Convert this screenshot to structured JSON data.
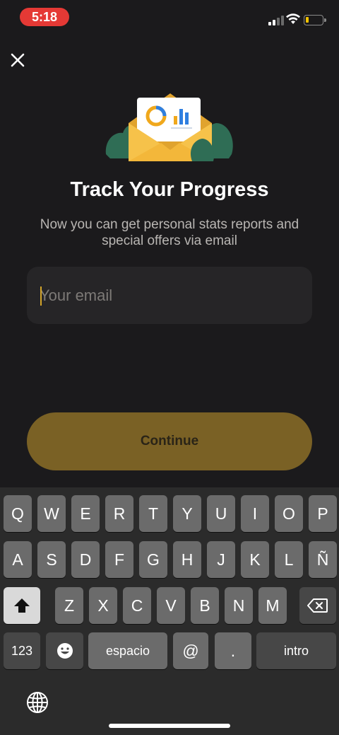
{
  "status": {
    "time": "5:18",
    "accent": "#e53935"
  },
  "header": {
    "close_icon": "close-icon"
  },
  "hero": {
    "title": "Track Your Progress",
    "subtitle": "Now you can get personal stats reports and special offers via email"
  },
  "form": {
    "email_placeholder": "Your email",
    "email_value": "",
    "continue_label": "Continue"
  },
  "keyboard": {
    "row1": [
      "Q",
      "W",
      "E",
      "R",
      "T",
      "Y",
      "U",
      "I",
      "O",
      "P"
    ],
    "row2": [
      "A",
      "S",
      "D",
      "F",
      "G",
      "H",
      "J",
      "K",
      "L",
      "Ñ"
    ],
    "row3": [
      "Z",
      "X",
      "C",
      "V",
      "B",
      "N",
      "M"
    ],
    "numbers_label": "123",
    "space_label": "espacio",
    "at_label": "@",
    "dot_label": ".",
    "return_label": "intro",
    "emoji_icon": "emoji-icon",
    "shift_icon": "shift-icon",
    "delete_icon": "delete-icon",
    "globe_icon": "globe-icon"
  },
  "colors": {
    "background": "#1b1a1c",
    "button": "#7a6125",
    "caret": "#d4a52a"
  }
}
